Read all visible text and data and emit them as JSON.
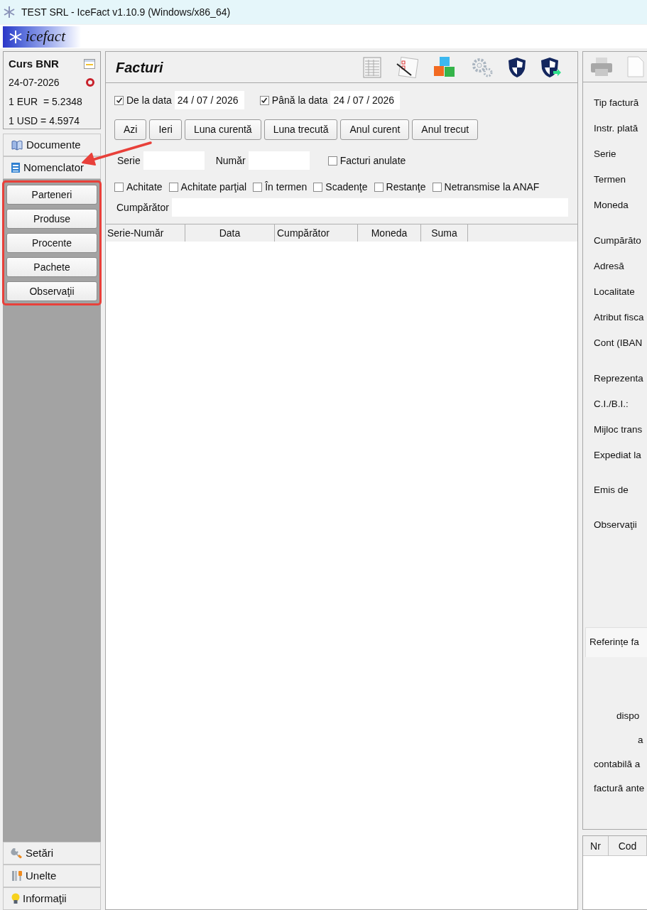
{
  "window": {
    "title": "TEST SRL - IceFact v1.10.9 (Windows/x86_64)"
  },
  "logo": {
    "text": "icefact"
  },
  "rates": {
    "title": "Curs BNR",
    "date": "24-07-2026",
    "lines": [
      "1 EUR  = 5.2348",
      "1 USD = 4.5974"
    ]
  },
  "nav_top": [
    {
      "label": "Documente",
      "kind": "book"
    },
    {
      "label": "Nomenclator",
      "kind": "list"
    }
  ],
  "nomenclator_buttons": [
    "Parteneri",
    "Produse",
    "Procente",
    "Pachete",
    "Observaţii"
  ],
  "nav_bottom": [
    {
      "label": "Setări",
      "kind": "wrench"
    },
    {
      "label": "Unelte",
      "kind": "tools"
    },
    {
      "label": "Informaţii",
      "kind": "bulb"
    }
  ],
  "invoices": {
    "title": "Facturi",
    "date_from": {
      "label": "De la data",
      "checked": true,
      "value": "24 / 07 / 2026"
    },
    "date_to": {
      "label": "Până la data",
      "checked": true,
      "value": "24 / 07 / 2026"
    },
    "quick_buttons": [
      "Azi",
      "Ieri",
      "Luna curentă",
      "Luna trecută",
      "Anul curent",
      "Anul trecut"
    ],
    "serie": {
      "label": "Serie"
    },
    "numar": {
      "label": "Număr"
    },
    "cancelled": {
      "label": "Facturi anulate",
      "checked": false
    },
    "status_filters": [
      {
        "label": "Achitate",
        "checked": false
      },
      {
        "label": "Achitate parţial",
        "checked": false
      },
      {
        "label": "În termen",
        "checked": false
      },
      {
        "label": "Scadenţe",
        "checked": false
      },
      {
        "label": "Restanţe",
        "checked": false
      },
      {
        "label": "Netransmise la ANAF",
        "checked": false
      }
    ],
    "buyer": {
      "label": "Cumpărător"
    },
    "table": {
      "columns": [
        "Serie-Număr",
        "Data",
        "Cumpărător",
        "Moneda",
        "Suma"
      ]
    }
  },
  "details": {
    "groups": [
      [
        "Tip factură",
        "Instr. plată",
        "Serie",
        "Termen",
        "Moneda"
      ],
      [
        "Cumpărăto",
        "Adresă",
        "Localitate",
        "Atribut fisca",
        "Cont (IBAN"
      ],
      [
        "Reprezenta",
        "C.I./B.I.:",
        "Mijloc trans",
        "Expediat la"
      ],
      [
        "Emis de"
      ],
      [
        "Observaţii"
      ]
    ],
    "references": {
      "title": "Referințe fa",
      "lines": [
        "dispo",
        "a",
        "contabilă a",
        "factură ante"
      ]
    },
    "items_table": {
      "columns": [
        "Nr",
        "Cod"
      ]
    }
  }
}
